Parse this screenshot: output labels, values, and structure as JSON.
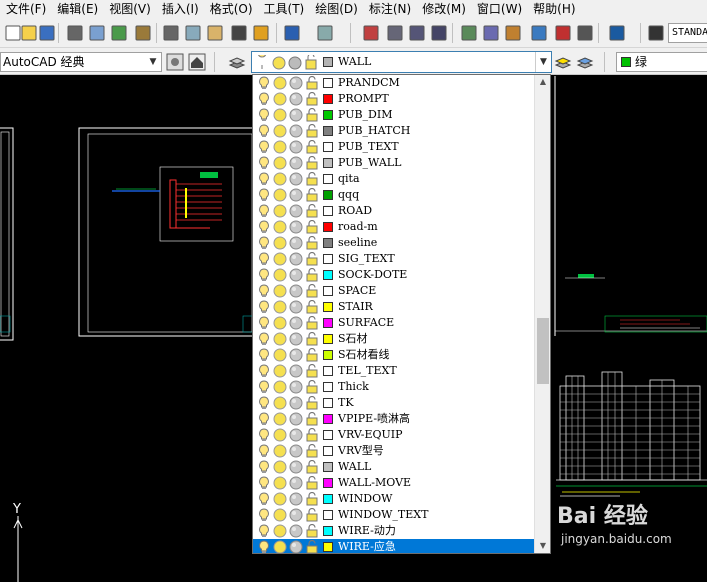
{
  "menu": [
    "文件(F)",
    "编辑(E)",
    "视图(V)",
    "插入(I)",
    "格式(O)",
    "工具(T)",
    "绘图(D)",
    "标注(N)",
    "修改(M)",
    "窗口(W)",
    "帮助(H)"
  ],
  "toolbar": {
    "text_style_value": "STANDA",
    "icons": [
      "new-icon",
      "open-icon",
      "save-icon",
      "print-icon",
      "print-preview-icon",
      "publish-icon",
      "plot-icon",
      "cut-icon",
      "copy-icon",
      "paste-icon",
      "brush-icon",
      "match-properties-icon",
      "undo-icon",
      "redo-icon",
      "pan-icon",
      "zoom-realtime-icon",
      "zoom-window-icon",
      "zoom-previous-icon",
      "properties-icon",
      "design-center-icon",
      "tool-palettes-icon",
      "sheet-set-icon",
      "markup-icon",
      "calculator-icon",
      "help-icon",
      "text-style-icon"
    ]
  },
  "workspace": {
    "value": "AutoCAD 经典"
  },
  "layer_combo": {
    "value": "WALL",
    "swatch": "#b4b4b4"
  },
  "color_combo": {
    "value": "绿",
    "swatch": "#00c000"
  },
  "layers": [
    {
      "name": "PRANDCM",
      "color": "#ffffff"
    },
    {
      "name": "PROMPT",
      "color": "#ff0000"
    },
    {
      "name": "PUB_DIM",
      "color": "#00c800"
    },
    {
      "name": "PUB_HATCH",
      "color": "#808080"
    },
    {
      "name": "PUB_TEXT",
      "color": "#ffffff"
    },
    {
      "name": "PUB_WALL",
      "color": "#c0c0c0"
    },
    {
      "name": "qita",
      "color": "#ffffff"
    },
    {
      "name": "qqq",
      "color": "#00a000"
    },
    {
      "name": "ROAD",
      "color": "#ffffff"
    },
    {
      "name": "road-m",
      "color": "#ff0000"
    },
    {
      "name": "seeline",
      "color": "#808080"
    },
    {
      "name": "SIG_TEXT",
      "color": "#ffffff"
    },
    {
      "name": "SOCK-DOTE",
      "color": "#00ffff"
    },
    {
      "name": "SPACE",
      "color": "#ffffff"
    },
    {
      "name": "STAIR",
      "color": "#ffff00"
    },
    {
      "name": "SURFACE",
      "color": "#ff00ff"
    },
    {
      "name": "S石材",
      "color": "#ffff00"
    },
    {
      "name": "S石材看线",
      "color": "#ccff00"
    },
    {
      "name": "TEL_TEXT",
      "color": "#ffffff"
    },
    {
      "name": "Thick",
      "color": "#ffffff"
    },
    {
      "name": "TK",
      "color": "#ffffff"
    },
    {
      "name": "VPIPE-喷淋高",
      "color": "#ff00ff"
    },
    {
      "name": "VRV-EQUIP",
      "color": "#ffffff"
    },
    {
      "name": "VRV型号",
      "color": "#ffffff"
    },
    {
      "name": "WALL",
      "color": "#c0c0c0"
    },
    {
      "name": "WALL-MOVE",
      "color": "#ff00ff"
    },
    {
      "name": "WINDOW",
      "color": "#00ffff"
    },
    {
      "name": "WINDOW_TEXT",
      "color": "#ffffff"
    },
    {
      "name": "WIRE-动力",
      "color": "#00ffff"
    },
    {
      "name": "WIRE-应急",
      "color": "#ffff00"
    }
  ],
  "selected_layer": "WIRE-应急",
  "drawing": {
    "ucs_y_label": "Y"
  },
  "watermark": {
    "logo": "Bai 经验",
    "url": "jingyan.baidu.com"
  }
}
